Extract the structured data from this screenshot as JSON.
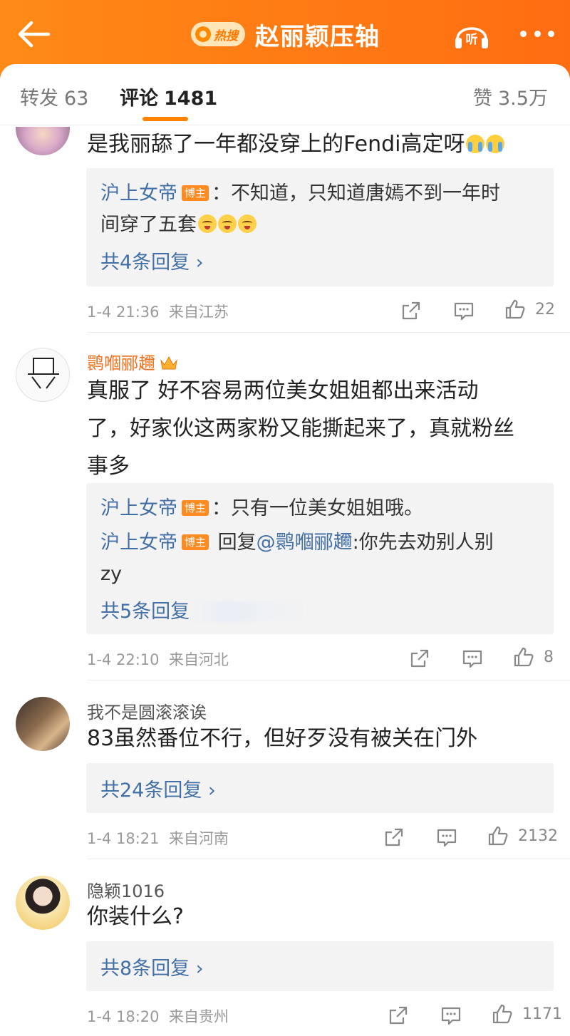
{
  "header": {
    "hot_badge": "热搜",
    "title": "赵丽颖压轴",
    "listen_label": "听"
  },
  "tabs": {
    "repost_label": "转发",
    "repost_count": "63",
    "comment_label": "评论",
    "comment_count": "1481",
    "like_label": "赞",
    "like_count": "3.5万"
  },
  "comments": [
    {
      "text": "是我丽舔了一年都没穿上的Fendi高定呀",
      "replies": [
        {
          "name": "沪上女帝",
          "badge": "博主",
          "text1": "：不知道，只知道唐嫣不到一年时",
          "text2": "间穿了五套"
        }
      ],
      "more_replies": "共4条回复 ›",
      "time": "1-4 21:36",
      "location": "来自江苏",
      "likes": "22"
    },
    {
      "user": "鹮嗰郦趰",
      "text_lines": [
        "真服了 好不容易两位美女姐姐都出来活动",
        "了，好家伙这两家粉又能撕起来了，真就粉丝",
        "事多"
      ],
      "replies": [
        {
          "name": "沪上女帝",
          "badge": "博主",
          "text": "：只有一位美女姐姐哦。"
        },
        {
          "name": "沪上女帝",
          "badge": "博主",
          "text_prefix": " 回复",
          "mention": "@鹮嗰郦趰",
          "text_after": ":你先去劝别人别",
          "text2": "zy"
        }
      ],
      "more_replies": "共5条回复",
      "time": "1-4 22:10",
      "location": "来自河北",
      "likes": "8"
    },
    {
      "user": "我不是圆滚滚诶",
      "text": "83虽然番位不行，但好歹没有被关在门外",
      "more_replies": "共24条回复 ›",
      "time": "1-4 18:21",
      "location": "来自河南",
      "likes": "2132"
    },
    {
      "user": "隐颖1016",
      "text": "你装什么?",
      "more_replies": "共8条回复 ›",
      "time": "1-4 18:20",
      "location": "来自贵州",
      "likes": "1171"
    }
  ],
  "colors": {
    "header_orange": "#ff7a14",
    "link_blue": "#4270a6",
    "tab_underline": "#ff8200",
    "username_orange": "#f37221"
  },
  "icons": [
    "back-arrow-icon",
    "hot-search-icon",
    "listen-icon",
    "more-icon",
    "share-icon",
    "comment-icon",
    "like-icon",
    "crown-icon",
    "cry-emoji-icon",
    "smug-emoji-icon"
  ]
}
